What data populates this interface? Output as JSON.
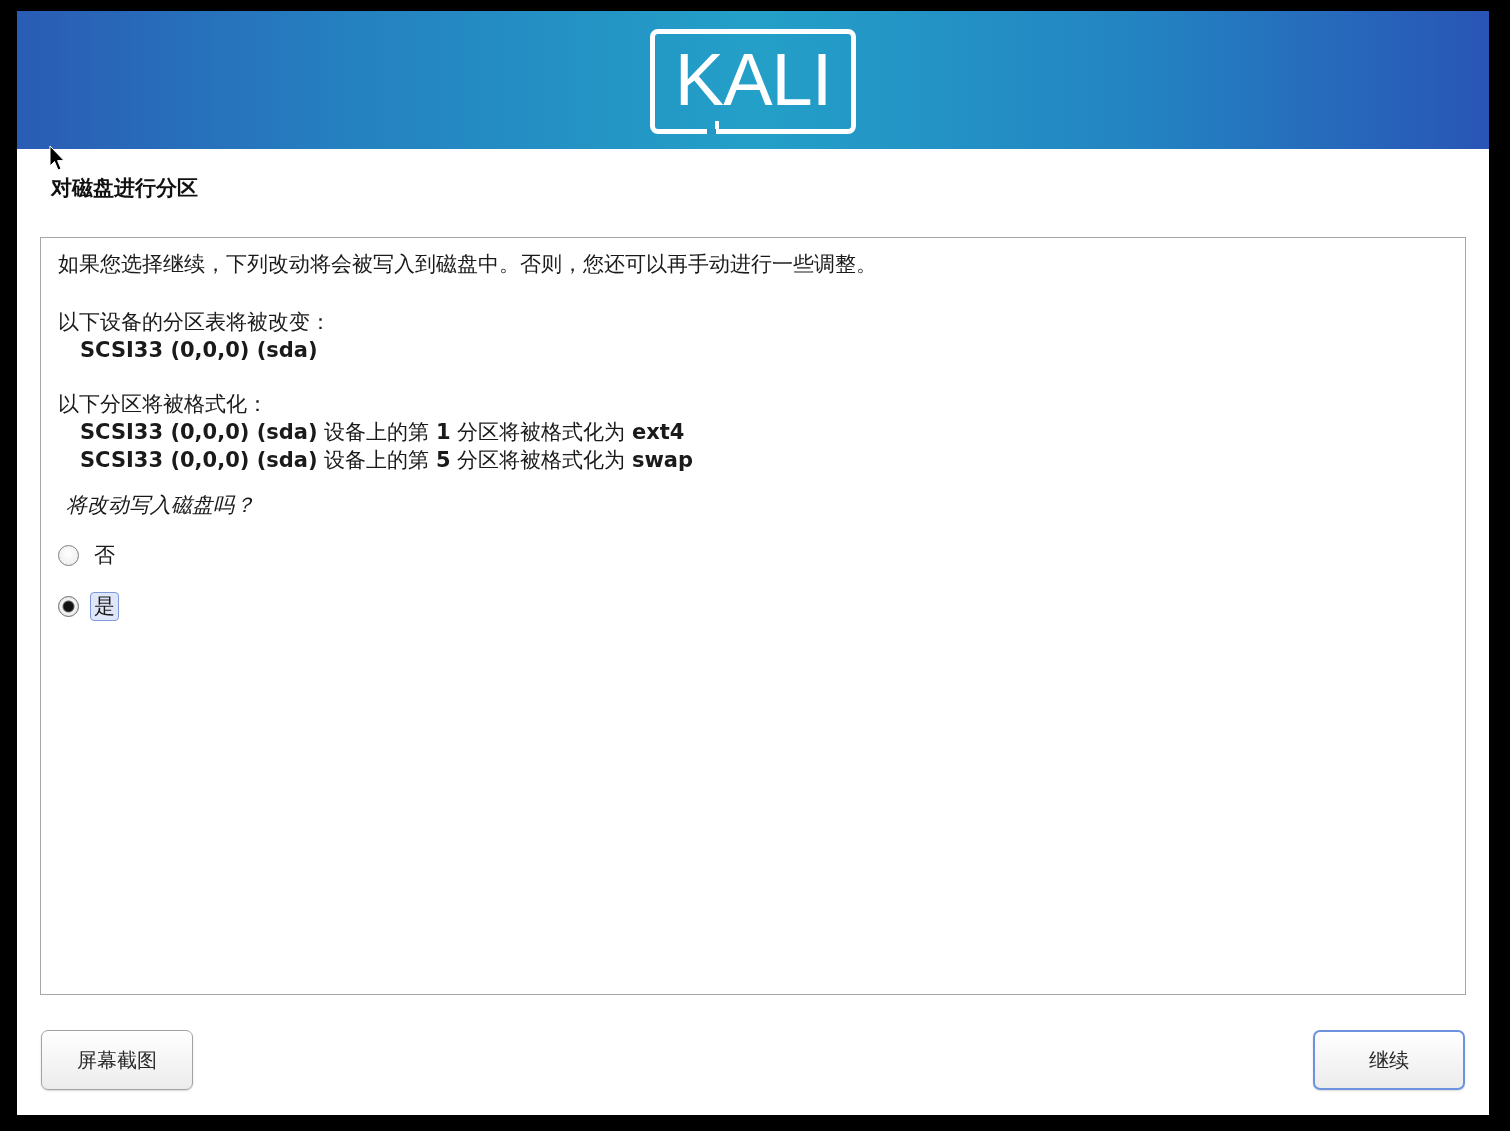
{
  "header": {
    "logo": "KALI"
  },
  "title": "对磁盘进行分区",
  "panel": {
    "intro": "如果您选择继续，下列改动将会被写入到磁盘中。否则，您还可以再手动进行一些调整。",
    "sections": [
      {
        "kind": "devices",
        "heading": "以下设备的分区表将被改变：",
        "items": [
          "SCSI33 (0,0,0) (sda)"
        ]
      },
      {
        "kind": "formats",
        "heading": "以下分区将被格式化：",
        "items": [
          "**SCSI33 (0,0,0) (sda)** 设备上的第 **1** 分区将被格式化为 **ext4**",
          "**SCSI33 (0,0,0) (sda)** 设备上的第 **5** 分区将被格式化为 **swap**"
        ]
      }
    ],
    "question": "将改动写入磁盘吗？",
    "options": [
      {
        "label": "否",
        "selected": false
      },
      {
        "label": "是",
        "selected": true
      }
    ]
  },
  "buttons": [
    {
      "label": "屏幕截图",
      "focused": false
    },
    {
      "label": "继续",
      "focused": true
    }
  ]
}
